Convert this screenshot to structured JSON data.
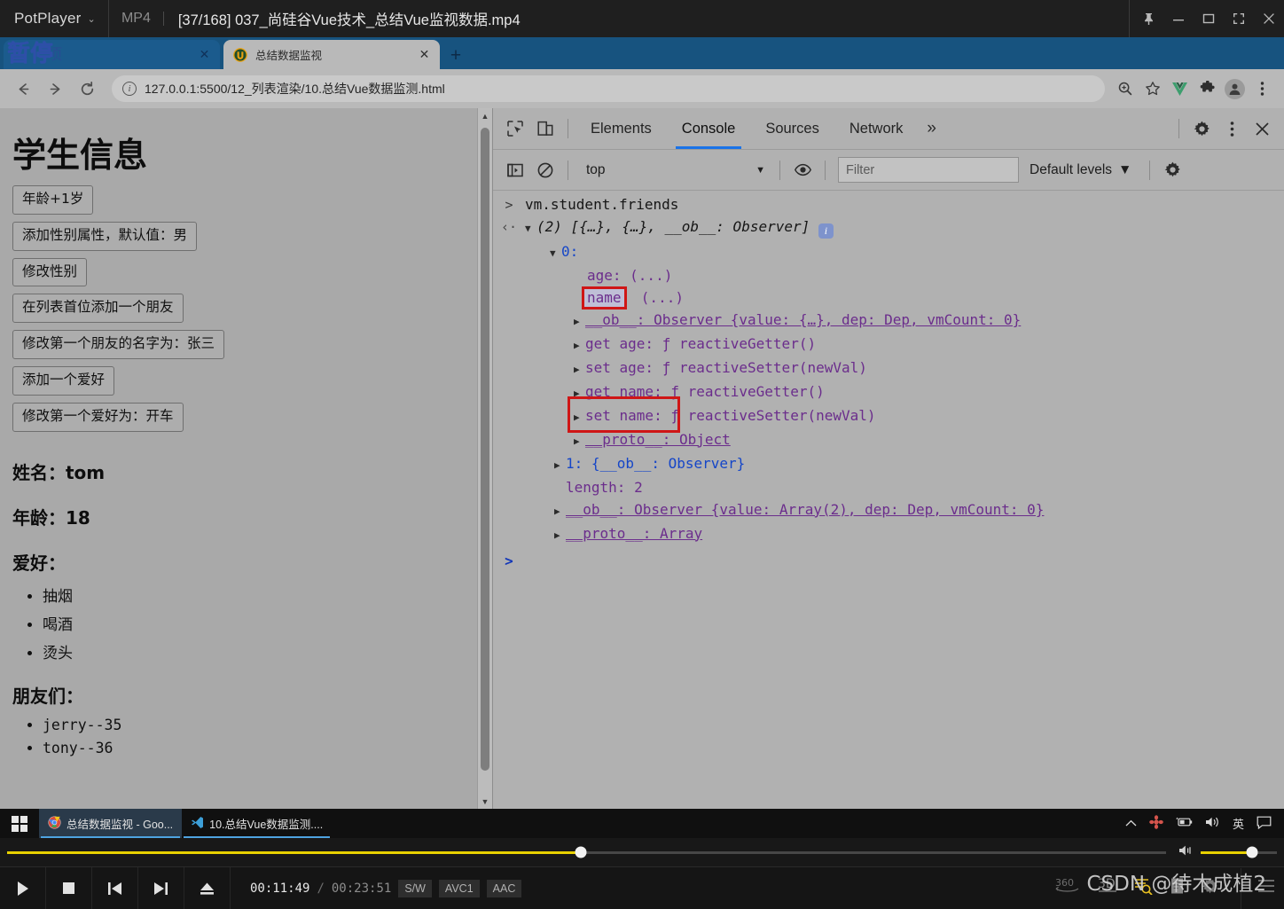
{
  "potplayer": {
    "app_name": "PotPlayer",
    "format": "MP4",
    "title": "[37/168] 037_尚硅谷Vue技术_总结Vue监视数据.mp4",
    "window_buttons": [
      "pin",
      "minimize",
      "maximize",
      "fullscreen",
      "close"
    ],
    "pause_overlay": "暂停",
    "pause_ghost": "项",
    "time_current": "00:11:49",
    "time_separator": "/",
    "time_total": "00:23:51",
    "chips": [
      "S/W",
      "AVC1",
      "AAC"
    ],
    "controls": [
      "play",
      "stop",
      "previous",
      "next",
      "eject"
    ],
    "right_controls": [
      "360",
      "3D",
      "playlist-search",
      "playlist",
      "settings",
      "menu"
    ],
    "seek_percent": 49.5,
    "volume_percent": 68,
    "watermark": "CSDN @待木成植2",
    "accent_color": "#e8d100"
  },
  "browser": {
    "tabs": [
      {
        "title": "",
        "active": false
      },
      {
        "title": "总结数据监视",
        "active": true
      }
    ],
    "new_tab_label": "+",
    "nav": {
      "back": "←",
      "forward": "→",
      "reload": "C"
    },
    "url": "127.0.0.1:5500/12_列表渲染/10.总结Vue数据监测.html",
    "omni_icons": [
      "zoom-icon",
      "bookmark-star-icon",
      "vue-devtools-icon",
      "extensions-icon",
      "profile-avatar",
      "chrome-menu-icon"
    ]
  },
  "page": {
    "heading": "学生信息",
    "buttons": [
      "年龄+1岁",
      "添加性别属性，默认值：男",
      "修改性别",
      "在列表首位添加一个朋友",
      "修改第一个朋友的名字为：张三",
      "添加一个爱好",
      "修改第一个爱好为：开车"
    ],
    "fields": [
      {
        "label": "姓名：",
        "value": "tom"
      },
      {
        "label": "年龄：",
        "value": "18"
      }
    ],
    "hobbies_label": "爱好：",
    "hobbies": [
      "抽烟",
      "喝酒",
      "烫头"
    ],
    "friends_label": "朋友们：",
    "friends": [
      "jerry--35",
      "tony--36"
    ]
  },
  "devtools": {
    "left_icons": [
      "inspect-element-icon",
      "device-toolbar-icon"
    ],
    "tabs": [
      "Elements",
      "Console",
      "Sources",
      "Network"
    ],
    "selected_tab": "Console",
    "more_tabs": "»",
    "right_icons": [
      "settings-gear-icon",
      "devtools-menu-icon",
      "close-devtools-icon"
    ],
    "toolbar": {
      "sidebar_toggle": "console-sidebar-icon",
      "clear": "clear-console-icon",
      "context": "top",
      "context_caret": "▼",
      "eye": "live-expression-icon",
      "filter_placeholder": "Filter",
      "levels": "Default levels",
      "levels_caret": "▼",
      "settings": "console-settings-icon"
    },
    "console": {
      "input_command": "vm.student.friends",
      "result_header": "(2) [{…}, {…}, __ob__: Observer]",
      "info_badge": "i",
      "rows": [
        {
          "indent": 1,
          "tri": "open",
          "text": "0:"
        },
        {
          "indent": 2,
          "tri": "none",
          "text": "age: (...)"
        },
        {
          "indent": 2,
          "tri": "none",
          "text": "name (...)",
          "highlight": "name"
        },
        {
          "indent": 2,
          "tri": "closed",
          "text": "__ob__: Observer {value: {…}, dep: Dep, vmCount: 0}"
        },
        {
          "indent": 2,
          "tri": "closed",
          "text": "get age: ƒ reactiveGetter()"
        },
        {
          "indent": 2,
          "tri": "closed",
          "text": "set age: ƒ reactiveSetter(newVal)"
        },
        {
          "indent": 2,
          "tri": "closed",
          "text": "get name: ƒ reactiveGetter()"
        },
        {
          "indent": 2,
          "tri": "closed",
          "text": "set name: ƒ reactiveSetter(newVal)"
        },
        {
          "indent": 2,
          "tri": "closed",
          "text": "__proto__: Object"
        },
        {
          "indent": 1,
          "tri": "closed",
          "text": "1: {__ob__: Observer}"
        },
        {
          "indent": 1,
          "tri": "none",
          "text": "length: 2"
        },
        {
          "indent": 0,
          "tri": "closed",
          "text": "__ob__: Observer {value: Array(2), dep: Dep, vmCount: 0}"
        },
        {
          "indent": 0,
          "tri": "closed",
          "text": "__proto__: Array"
        }
      ],
      "prompt_caret": ">",
      "annotation_color": "#cf1616"
    }
  },
  "taskbar": {
    "start": "windows-start-icon",
    "items": [
      {
        "label": "总结数据监视 - Goo...",
        "icon": "chrome-icon"
      },
      {
        "label": "10.总结Vue数据监测....",
        "icon": "vscode-icon"
      }
    ],
    "tray": [
      "show-hidden-icons",
      "app-tray-icon",
      "battery-icon",
      "volume-icon",
      "ime-indicator",
      "notifications-icon"
    ],
    "ime_label": "英"
  }
}
